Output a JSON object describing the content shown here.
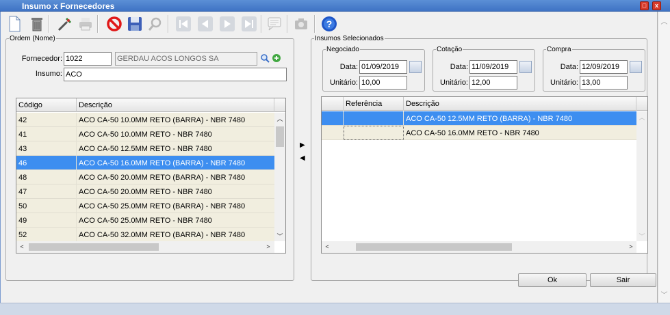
{
  "window": {
    "title": "Insumo x Fornecedores"
  },
  "left": {
    "legend": "Ordem (Nome)",
    "fornecedor_label": "Fornecedor:",
    "fornecedor_code": "1022",
    "fornecedor_name": "GERDAU ACOS LONGOS SA",
    "insumo_label": "Insumo:",
    "insumo_value": "ACO",
    "columns": [
      "Código",
      "Descrição"
    ],
    "rows": [
      {
        "code": "42",
        "desc": "ACO CA-50 10.0MM RETO (BARRA) - NBR 7480"
      },
      {
        "code": "41",
        "desc": "ACO CA-50 10.0MM RETO - NBR 7480"
      },
      {
        "code": "43",
        "desc": "ACO CA-50 12.5MM RETO - NBR 7480"
      },
      {
        "code": "46",
        "desc": "ACO CA-50 16.0MM RETO (BARRA) - NBR 7480"
      },
      {
        "code": "48",
        "desc": "ACO CA-50 20.0MM RETO (BARRA) - NBR 7480"
      },
      {
        "code": "47",
        "desc": "ACO CA-50 20.0MM RETO - NBR 7480"
      },
      {
        "code": "50",
        "desc": "ACO CA-50 25.0MM RETO (BARRA) - NBR 7480"
      },
      {
        "code": "49",
        "desc": "ACO CA-50 25.0MM RETO - NBR 7480"
      },
      {
        "code": "52",
        "desc": "ACO CA-50 32.0MM RETO (BARRA) - NBR 7480"
      }
    ]
  },
  "right": {
    "legend": "Insumos Selecionados",
    "negociado": {
      "legend": "Negociado",
      "data_label": "Data:",
      "data": "01/09/2019",
      "unit_label": "Unitário:",
      "unit": "10,00"
    },
    "cotacao": {
      "legend": "Cotação",
      "data_label": "Data:",
      "data": "11/09/2019",
      "unit_label": "Unitário:",
      "unit": "12,00"
    },
    "compra": {
      "legend": "Compra",
      "data_label": "Data:",
      "data": "12/09/2019",
      "unit_label": "Unitário:",
      "unit": "13,00"
    },
    "columns": [
      "Referência",
      "Descrição"
    ],
    "rows": [
      {
        "ref": "",
        "desc": "ACO CA-50 12.5MM RETO (BARRA) - NBR 7480"
      },
      {
        "ref": "",
        "desc": "ACO CA-50 16.0MM RETO - NBR 7480"
      }
    ]
  },
  "buttons": {
    "ok": "Ok",
    "sair": "Sair"
  },
  "arrows": {
    "right": "▶",
    "left": "◀"
  }
}
